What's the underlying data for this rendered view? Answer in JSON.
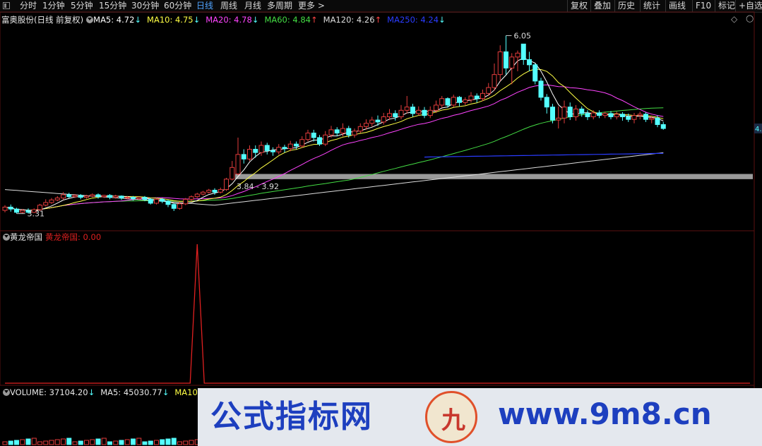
{
  "toolbar": {
    "left_items": [
      "分时",
      "1分钟",
      "5分钟",
      "15分钟",
      "30分钟",
      "60分钟",
      "日线",
      "周线",
      "月线",
      "多周期",
      "更多 >"
    ],
    "active": "日线",
    "right_items": [
      "复权",
      "叠加",
      "历史",
      "统计",
      "画线",
      "F10",
      "标记",
      "+自选"
    ]
  },
  "main_legend": {
    "stock": "富奥股份(日线 前复权)",
    "ma5": "MA5: 4.72",
    "ma10": "MA10: 4.75",
    "ma20": "MA20: 4.78",
    "ma60": "MA60: 4.84",
    "ma120": "MA120: 4.26",
    "ma250": "MA250: 4.24",
    "arrows": {
      "ma5": "↓",
      "ma10": "↓",
      "ma20": "↓",
      "ma60": "↑",
      "ma120": "↑",
      "ma250": "↓"
    }
  },
  "indicator_legend": {
    "name": "黄龙帝国",
    "value_label": "黄龙帝国: 0.00"
  },
  "volume_legend": {
    "volume": "VOLUME: 37104.20",
    "ma5": "MA5: 45030.77",
    "ma10": "MA10: 4"
  },
  "watermark": {
    "left": "公式指标网",
    "right": "www.9m8.cn",
    "logo": "九"
  },
  "colors": {
    "up": "#e23c3c",
    "down": "#54ffff",
    "ma5": "#ffffff",
    "ma10": "#ffff44",
    "ma20": "#ff44ff",
    "ma60": "#44dd44",
    "ma120": "#dddddd",
    "ma250": "#2a3cff",
    "band": "#9a9a9a",
    "indicator": "#e02020"
  },
  "chart_data": [
    {
      "type": "candlestick",
      "title": "富奥股份(日线 前复权)",
      "annotations": [
        {
          "text": "6.05",
          "kind": "high"
        },
        {
          "text": "3.31",
          "kind": "low"
        },
        {
          "text": "3.84 - 3.92",
          "kind": "gap"
        }
      ],
      "right_price_label": "4.",
      "candles": [
        [
          3.36,
          3.41,
          3.33,
          3.44
        ],
        [
          3.41,
          3.38,
          3.34,
          3.45
        ],
        [
          3.38,
          3.33,
          3.31,
          3.4
        ],
        [
          3.33,
          3.36,
          3.31,
          3.38
        ],
        [
          3.36,
          3.33,
          3.31,
          3.39
        ],
        [
          3.33,
          3.37,
          3.32,
          3.39
        ],
        [
          3.37,
          3.44,
          3.35,
          3.46
        ],
        [
          3.44,
          3.48,
          3.42,
          3.53
        ],
        [
          3.48,
          3.52,
          3.46,
          3.55
        ],
        [
          3.52,
          3.55,
          3.5,
          3.58
        ],
        [
          3.55,
          3.6,
          3.52,
          3.64
        ],
        [
          3.6,
          3.57,
          3.55,
          3.63
        ],
        [
          3.57,
          3.59,
          3.55,
          3.61
        ],
        [
          3.59,
          3.56,
          3.53,
          3.61
        ],
        [
          3.56,
          3.58,
          3.54,
          3.6
        ],
        [
          3.58,
          3.6,
          3.56,
          3.62
        ],
        [
          3.6,
          3.57,
          3.54,
          3.62
        ],
        [
          3.57,
          3.59,
          3.55,
          3.6
        ],
        [
          3.59,
          3.56,
          3.53,
          3.61
        ],
        [
          3.56,
          3.58,
          3.54,
          3.6
        ],
        [
          3.58,
          3.55,
          3.52,
          3.59
        ],
        [
          3.55,
          3.56,
          3.53,
          3.58
        ],
        [
          3.56,
          3.54,
          3.51,
          3.58
        ],
        [
          3.54,
          3.56,
          3.52,
          3.57
        ],
        [
          3.56,
          3.53,
          3.5,
          3.58
        ],
        [
          3.53,
          3.47,
          3.45,
          3.55
        ],
        [
          3.47,
          3.53,
          3.45,
          3.55
        ],
        [
          3.53,
          3.5,
          3.47,
          3.55
        ],
        [
          3.5,
          3.45,
          3.41,
          3.52
        ],
        [
          3.45,
          3.39,
          3.35,
          3.47
        ],
        [
          3.39,
          3.46,
          3.37,
          3.49
        ],
        [
          3.46,
          3.53,
          3.44,
          3.55
        ],
        [
          3.53,
          3.57,
          3.5,
          3.59
        ],
        [
          3.57,
          3.61,
          3.55,
          3.63
        ],
        [
          3.61,
          3.64,
          3.59,
          3.66
        ],
        [
          3.64,
          3.67,
          3.62,
          3.69
        ],
        [
          3.67,
          3.64,
          3.6,
          3.7
        ],
        [
          3.64,
          3.68,
          3.62,
          3.71
        ],
        [
          3.68,
          3.84,
          3.66,
          3.86
        ],
        [
          3.84,
          4.02,
          3.82,
          4.12
        ],
        [
          3.92,
          4.22,
          3.9,
          4.48
        ],
        [
          4.22,
          4.15,
          4.08,
          4.3
        ],
        [
          4.15,
          4.3,
          4.12,
          4.36
        ],
        [
          4.3,
          4.25,
          4.17,
          4.36
        ],
        [
          4.25,
          4.36,
          4.2,
          4.42
        ],
        [
          4.36,
          4.28,
          4.22,
          4.4
        ],
        [
          4.28,
          4.26,
          4.2,
          4.33
        ],
        [
          4.26,
          4.33,
          4.22,
          4.38
        ],
        [
          4.33,
          4.31,
          4.25,
          4.37
        ],
        [
          4.31,
          4.38,
          4.27,
          4.43
        ],
        [
          4.38,
          4.35,
          4.3,
          4.42
        ],
        [
          4.35,
          4.45,
          4.32,
          4.5
        ],
        [
          4.45,
          4.55,
          4.42,
          4.6
        ],
        [
          4.55,
          4.48,
          4.42,
          4.6
        ],
        [
          4.48,
          4.38,
          4.35,
          4.52
        ],
        [
          4.38,
          4.52,
          4.35,
          4.58
        ],
        [
          4.52,
          4.6,
          4.48,
          4.66
        ],
        [
          4.6,
          4.55,
          4.5,
          4.64
        ],
        [
          4.55,
          4.62,
          4.5,
          4.7
        ],
        [
          4.62,
          4.52,
          4.48,
          4.66
        ],
        [
          4.52,
          4.58,
          4.48,
          4.62
        ],
        [
          4.58,
          4.65,
          4.55,
          4.7
        ],
        [
          4.65,
          4.7,
          4.6,
          4.76
        ],
        [
          4.7,
          4.75,
          4.65,
          4.8
        ],
        [
          4.75,
          4.72,
          4.66,
          4.82
        ],
        [
          4.72,
          4.8,
          4.68,
          4.86
        ],
        [
          4.8,
          4.85,
          4.75,
          4.92
        ],
        [
          4.85,
          4.8,
          4.74,
          4.9
        ],
        [
          4.8,
          4.9,
          4.76,
          4.98
        ],
        [
          4.9,
          4.95,
          4.85,
          5.12
        ],
        [
          4.95,
          4.85,
          4.8,
          5.0
        ],
        [
          4.85,
          4.9,
          4.82,
          4.96
        ],
        [
          4.9,
          4.82,
          4.78,
          4.95
        ],
        [
          4.82,
          4.9,
          4.78,
          4.96
        ],
        [
          4.9,
          4.98,
          4.86,
          5.05
        ],
        [
          4.98,
          5.08,
          4.94,
          5.12
        ],
        [
          5.08,
          4.98,
          4.94,
          5.1
        ],
        [
          4.98,
          5.1,
          4.95,
          5.14
        ],
        [
          5.1,
          5.02,
          4.96,
          5.12
        ],
        [
          5.02,
          5.06,
          4.98,
          5.1
        ],
        [
          5.06,
          5.12,
          5.02,
          5.18
        ],
        [
          5.12,
          5.08,
          5.02,
          5.16
        ],
        [
          5.08,
          5.16,
          5.04,
          5.22
        ],
        [
          5.16,
          5.25,
          5.12,
          5.32
        ],
        [
          5.25,
          5.45,
          5.2,
          5.62
        ],
        [
          5.45,
          5.8,
          5.35,
          5.9
        ],
        [
          5.8,
          5.55,
          5.45,
          6.05
        ],
        [
          5.55,
          5.72,
          5.3,
          5.78
        ],
        [
          5.72,
          5.78,
          5.5,
          5.82
        ],
        [
          5.92,
          5.68,
          5.6,
          5.92
        ],
        [
          5.68,
          5.6,
          5.5,
          5.8
        ],
        [
          5.6,
          5.35,
          5.3,
          5.62
        ],
        [
          5.35,
          5.1,
          5.05,
          5.4
        ],
        [
          5.1,
          4.95,
          4.85,
          5.15
        ],
        [
          4.95,
          4.75,
          4.7,
          5.0
        ],
        [
          4.75,
          4.78,
          4.62,
          4.96
        ],
        [
          4.78,
          4.95,
          4.7,
          5.05
        ],
        [
          4.95,
          4.8,
          4.75,
          5.02
        ],
        [
          4.8,
          4.92,
          4.74,
          4.98
        ],
        [
          4.92,
          4.85,
          4.8,
          4.96
        ],
        [
          4.85,
          4.8,
          4.75,
          4.9
        ],
        [
          4.8,
          4.86,
          4.76,
          4.9
        ],
        [
          4.86,
          4.82,
          4.78,
          4.9
        ],
        [
          4.82,
          4.85,
          4.78,
          4.88
        ],
        [
          4.85,
          4.8,
          4.76,
          4.89
        ],
        [
          4.8,
          4.84,
          4.76,
          4.88
        ],
        [
          4.84,
          4.8,
          4.74,
          4.87
        ],
        [
          4.8,
          4.76,
          4.72,
          4.85
        ],
        [
          4.76,
          4.82,
          4.7,
          4.86
        ],
        [
          4.82,
          4.84,
          4.76,
          4.88
        ],
        [
          4.84,
          4.76,
          4.72,
          4.87
        ],
        [
          4.76,
          4.78,
          4.7,
          4.82
        ],
        [
          4.78,
          4.68,
          4.64,
          4.82
        ],
        [
          4.68,
          4.62,
          4.6,
          4.72
        ]
      ]
    },
    {
      "type": "line",
      "title": "黄龙帝国",
      "series": [
        {
          "name": "黄龙帝国",
          "spike_index": 33,
          "spike_value": 1,
          "baseline": 0
        }
      ]
    },
    {
      "type": "bar",
      "title": "VOLUME",
      "series": [
        {
          "name": "VOLUME"
        }
      ]
    }
  ]
}
